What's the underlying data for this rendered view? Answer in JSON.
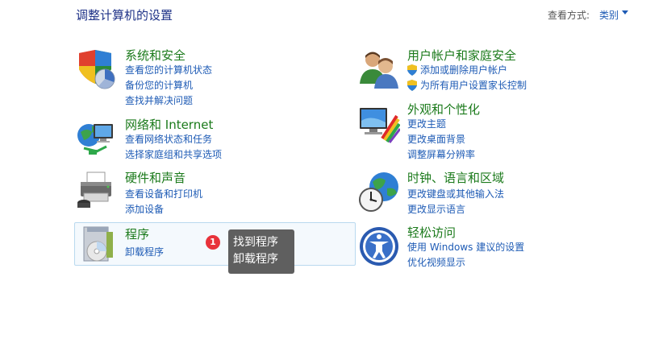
{
  "header": {
    "title": "调整计算机的设置",
    "view_by_label": "查看方式:",
    "view_by_value": "类别"
  },
  "categories": {
    "system": {
      "title": "系统和安全",
      "links": [
        "查看您的计算机状态",
        "备份您的计算机",
        "查找并解决问题"
      ]
    },
    "network": {
      "title": "网络和 Internet",
      "links": [
        "查看网络状态和任务",
        "选择家庭组和共享选项"
      ]
    },
    "hardware": {
      "title": "硬件和声音",
      "links": [
        "查看设备和打印机",
        "添加设备"
      ]
    },
    "programs": {
      "title": "程序",
      "links": [
        "卸载程序"
      ]
    },
    "users": {
      "title": "用户帐户和家庭安全",
      "links": [
        "添加或删除用户帐户",
        "为所有用户设置家长控制"
      ]
    },
    "appearance": {
      "title": "外观和个性化",
      "links": [
        "更改主题",
        "更改桌面背景",
        "调整屏幕分辨率"
      ]
    },
    "clock": {
      "title": "时钟、语言和区域",
      "links": [
        "更改键盘或其他输入法",
        "更改显示语言"
      ]
    },
    "ease": {
      "title": "轻松访问",
      "links": [
        "使用 Windows 建议的设置",
        "优化视频显示"
      ]
    }
  },
  "annotation": {
    "badge": "1",
    "lines": [
      "找到程序",
      "卸载程序"
    ]
  },
  "colors": {
    "title_green": "#1b7a1b",
    "link_blue": "#1e5bb5",
    "header_blue": "#1e3287",
    "badge_red": "#e8323a",
    "tooltip_gray": "#5f5f5f"
  }
}
